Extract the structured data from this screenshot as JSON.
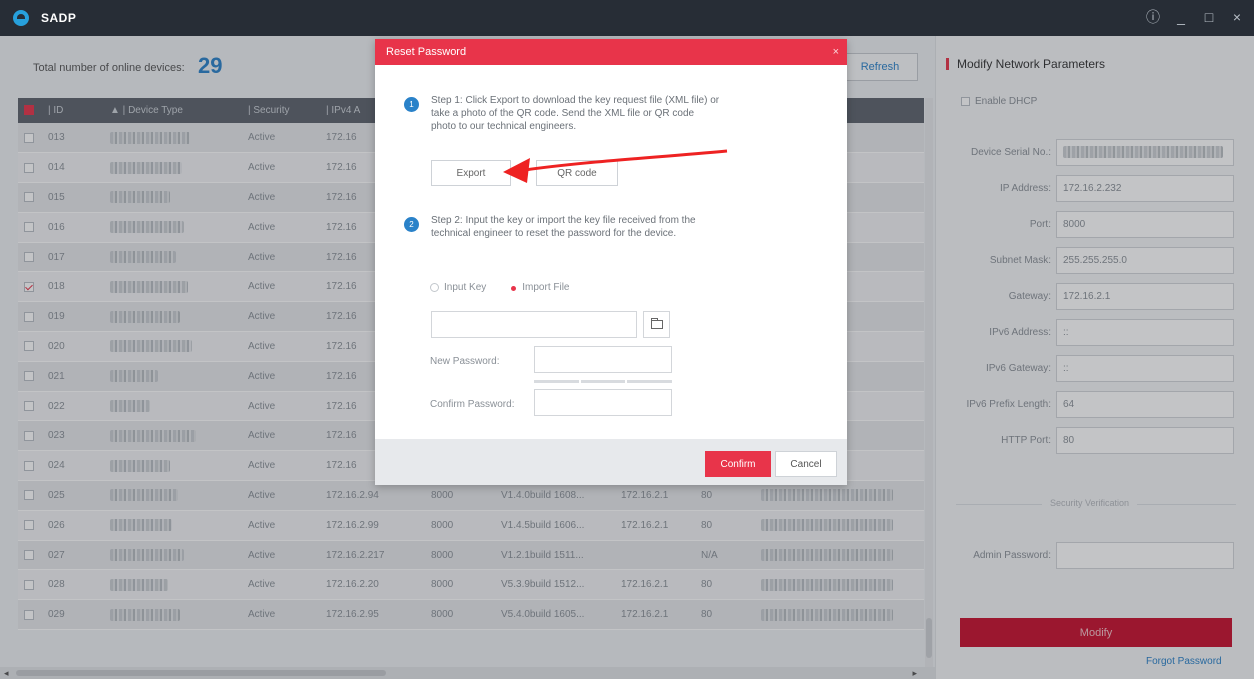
{
  "app": {
    "title": "SADP",
    "accent": "#e8344a",
    "modify_color": "#c8102e"
  },
  "window_controls": {
    "info": "ⓘ",
    "minimize": "_",
    "maximize": "□",
    "close": "×"
  },
  "top": {
    "total_label": "Total number of online devices:",
    "total_count": "29",
    "refresh_label": "Refresh"
  },
  "table": {
    "headers": {
      "id": "ID",
      "device_type": "Device Type",
      "security": "Security",
      "ipv4": "IPv4 A",
      "port": "",
      "software": "",
      "gateway": "",
      "http": "",
      "serial": "No."
    },
    "rows": [
      {
        "id": "013",
        "security": "Active",
        "ip": "172.16",
        "port": "",
        "software": "",
        "gateway": "",
        "http": "",
        "serial": "FWD-IZS20160",
        "checked": false
      },
      {
        "id": "014",
        "security": "Active",
        "ip": "172.16",
        "port": "",
        "software": "",
        "gateway": "",
        "http": "",
        "serial": "0B20160713-0",
        "checked": false
      },
      {
        "id": "015",
        "security": "Active",
        "ip": "172.16",
        "port": "",
        "software": "",
        "gateway": "",
        "http": "",
        "serial": "FWD20160314",
        "checked": false
      },
      {
        "id": "016",
        "security": "Active",
        "ip": "172.16",
        "port": "",
        "software": "",
        "gateway": "",
        "http": "",
        "serial": "F-EI201206256",
        "checked": false
      },
      {
        "id": "017",
        "security": "Active",
        "ip": "172.16",
        "port": "",
        "software": "",
        "gateway": "",
        "http": "",
        "serial": "-I50120131220",
        "checked": false
      },
      {
        "id": "018",
        "security": "Active",
        "ip": "172.16",
        "port": "",
        "software": "",
        "gateway": "",
        "http": "",
        "serial": "FWD-IZS20150",
        "checked": true
      },
      {
        "id": "019",
        "security": "Active",
        "ip": "172.16",
        "port": "",
        "software": "",
        "gateway": "",
        "http": "",
        "serial": "FWD-IS201508",
        "checked": false
      },
      {
        "id": "020",
        "security": "Active",
        "ip": "172.16",
        "port": "",
        "software": "",
        "gateway": "",
        "http": "",
        "serial": "F-EI012013040",
        "checked": false
      },
      {
        "id": "021",
        "security": "Active",
        "ip": "172.16",
        "port": "",
        "software": "",
        "gateway": "",
        "http": "",
        "serial": "0429AAWR594",
        "checked": false
      },
      {
        "id": "022",
        "security": "Active",
        "ip": "172.16",
        "port": "",
        "software": "",
        "gateway": "",
        "http": "",
        "serial": "40701AAWR47",
        "checked": false
      },
      {
        "id": "023",
        "security": "Active",
        "ip": "172.16",
        "port": "",
        "software": "",
        "gateway": "",
        "http": "",
        "serial": "FWD-I/H20141",
        "checked": false
      },
      {
        "id": "024",
        "security": "Active",
        "ip": "172.16",
        "port": "",
        "software": "",
        "gateway": "",
        "http": "",
        "serial": "120160622WR",
        "checked": false
      },
      {
        "id": "025",
        "security": "Active",
        "ip": "172.16.2.94",
        "port": "8000",
        "software": "V1.4.0build 1608...",
        "gateway": "172.16.2.1",
        "http": "80",
        "serial": "",
        "checked": false
      },
      {
        "id": "026",
        "security": "Active",
        "ip": "172.16.2.99",
        "port": "8000",
        "software": "V1.4.5build 1606...",
        "gateway": "172.16.2.1",
        "http": "80",
        "serial": "",
        "checked": false
      },
      {
        "id": "027",
        "security": "Active",
        "ip": "172.16.2.217",
        "port": "8000",
        "software": "V1.2.1build 1511...",
        "gateway": "",
        "http": "N/A",
        "serial": "",
        "checked": false
      },
      {
        "id": "028",
        "security": "Active",
        "ip": "172.16.2.20",
        "port": "8000",
        "software": "V5.3.9build 1512...",
        "gateway": "172.16.2.1",
        "http": "80",
        "serial": "",
        "checked": false
      },
      {
        "id": "029",
        "security": "Active",
        "ip": "172.16.2.95",
        "port": "8000",
        "software": "V5.4.0build 1605...",
        "gateway": "172.16.2.1",
        "http": "80",
        "serial": "",
        "checked": false
      }
    ]
  },
  "right": {
    "title": "Modify Network Parameters",
    "enable_dhcp": "Enable DHCP",
    "fields": [
      {
        "label": "Device Serial No.:",
        "value": "",
        "blurred": true
      },
      {
        "label": "IP Address:",
        "value": "172.16.2.232"
      },
      {
        "label": "Port:",
        "value": "8000"
      },
      {
        "label": "Subnet Mask:",
        "value": "255.255.255.0"
      },
      {
        "label": "Gateway:",
        "value": "172.16.2.1"
      },
      {
        "label": "IPv6 Address:",
        "value": "::"
      },
      {
        "label": "IPv6 Gateway:",
        "value": "::"
      },
      {
        "label": "IPv6 Prefix Length:",
        "value": "64"
      },
      {
        "label": "HTTP Port:",
        "value": "80"
      }
    ],
    "security_verification": "Security Verification",
    "admin_password_label": "Admin Password:",
    "modify_label": "Modify",
    "forgot_label": "Forgot Password"
  },
  "dialog": {
    "title": "Reset Password",
    "close": "×",
    "step1_num": "1",
    "step1_text": "Step 1: Click Export to download the key request file (XML file) or take a photo of the QR code. Send the XML file or QR code photo to our technical engineers.",
    "export_label": "Export",
    "qr_label": "QR code",
    "step2_num": "2",
    "step2_text": "Step 2: Input the key or import the key file received from the technical engineer to reset the password for the device.",
    "radio_input_key": "Input Key",
    "radio_import_file": "Import File",
    "new_password_label": "New Password:",
    "confirm_password_label": "Confirm Password:",
    "confirm_label": "Confirm",
    "cancel_label": "Cancel"
  },
  "icons": {
    "logo": "sadp-logo-icon",
    "folder": "folder-icon",
    "arrow": "red-annotation-arrow"
  }
}
